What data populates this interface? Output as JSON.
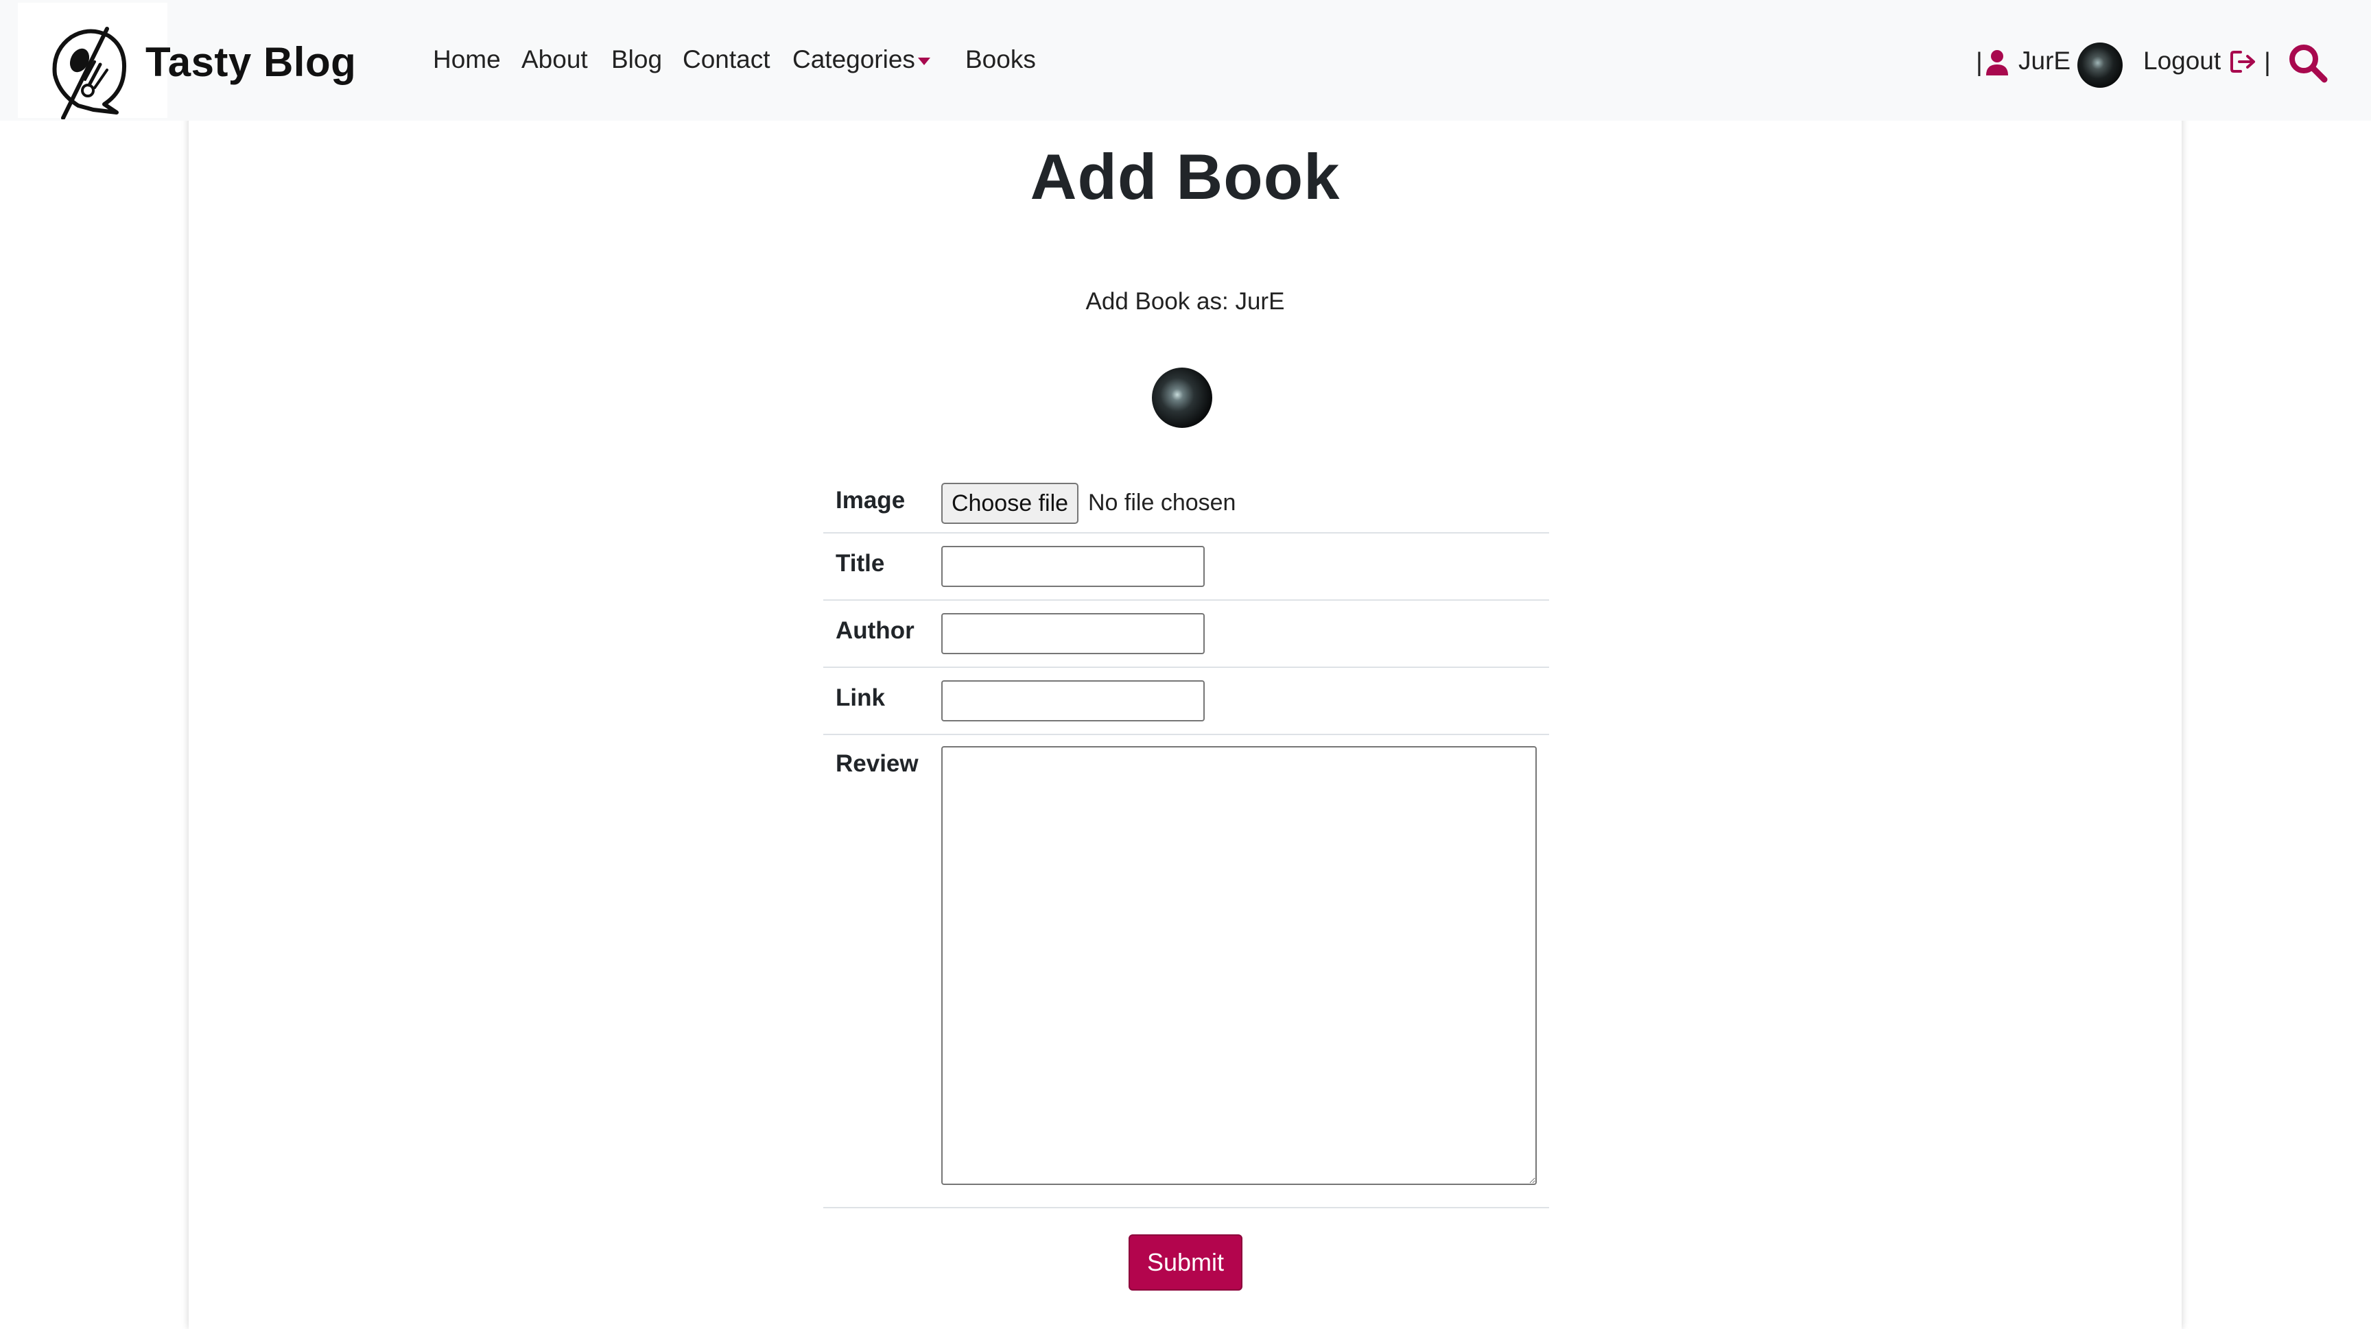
{
  "brand": {
    "name": "Tasty Blog"
  },
  "nav": {
    "home": "Home",
    "about": "About",
    "blog": "Blog",
    "contact": "Contact",
    "categories": "Categories",
    "books": "Books"
  },
  "user": {
    "pipe_left": "|",
    "name": "JurE",
    "logout": "Logout",
    "pipe_right": "|"
  },
  "page": {
    "title": "Add Book",
    "subtitle": "Add Book as: JurE"
  },
  "form": {
    "image_label": "Image",
    "choose_file": "Choose file",
    "file_status": "No file chosen",
    "title_label": "Title",
    "title_value": "",
    "author_label": "Author",
    "author_value": "",
    "link_label": "Link",
    "link_value": "",
    "review_label": "Review",
    "review_value": "",
    "submit": "Submit"
  },
  "colors": {
    "accent": "#b3054d",
    "navbar_bg": "#f8f9fa"
  }
}
